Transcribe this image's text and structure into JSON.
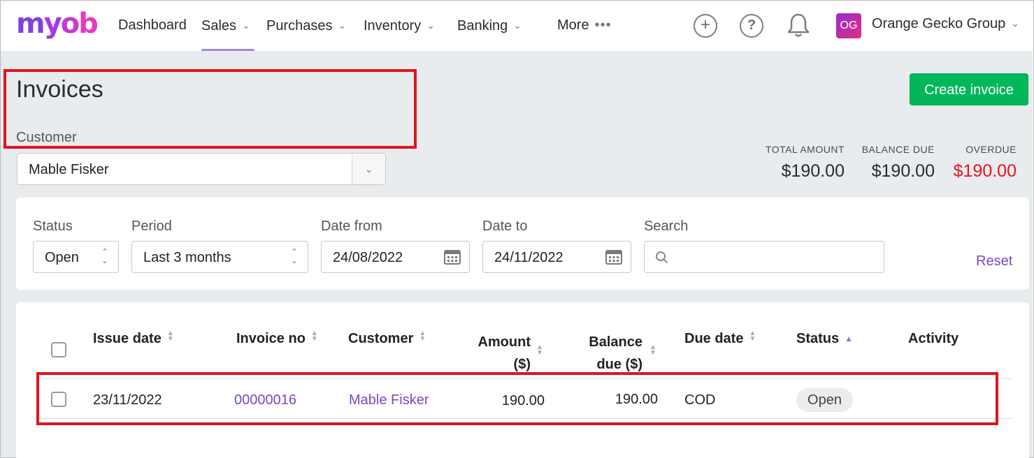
{
  "app": {
    "logo": "myob"
  },
  "nav": {
    "items": [
      {
        "label": "Dashboard"
      },
      {
        "label": "Sales"
      },
      {
        "label": "Purchases"
      },
      {
        "label": "Inventory"
      },
      {
        "label": "Banking"
      },
      {
        "label": "More"
      }
    ],
    "active": "Sales",
    "user_initials": "OG",
    "org_name": "Orange Gecko Group"
  },
  "page": {
    "title": "Invoices",
    "create_button": "Create invoice",
    "customer_label": "Customer",
    "customer_value": "Mable Fisker"
  },
  "totals": {
    "total_amount_label": "TOTAL AMOUNT",
    "total_amount": "$190.00",
    "balance_due_label": "BALANCE DUE",
    "balance_due": "$190.00",
    "overdue_label": "OVERDUE",
    "overdue": "$190.00"
  },
  "filters": {
    "status_label": "Status",
    "status_value": "Open",
    "period_label": "Period",
    "period_value": "Last 3 months",
    "date_from_label": "Date from",
    "date_from": "24/08/2022",
    "date_to_label": "Date to",
    "date_to": "24/11/2022",
    "search_label": "Search",
    "search_value": "",
    "reset": "Reset"
  },
  "table": {
    "headers": {
      "issue_date": "Issue date",
      "invoice_no": "Invoice no",
      "customer": "Customer",
      "amount_l1": "Amount",
      "amount_l2": "($)",
      "balance_l1": "Balance",
      "balance_l2": "due ($)",
      "due_date": "Due date",
      "status": "Status",
      "activity": "Activity"
    },
    "rows": [
      {
        "issue_date": "23/11/2022",
        "invoice_no": "00000016",
        "customer": "Mable Fisker",
        "amount": "190.00",
        "balance_due": "190.00",
        "due_date": "COD",
        "status": "Open"
      }
    ]
  },
  "colors": {
    "brand": "#8241dc",
    "primary_button": "#00b85a",
    "link": "#7b46c8",
    "overdue": "#e8141c",
    "highlight_box": "#e0141e"
  }
}
